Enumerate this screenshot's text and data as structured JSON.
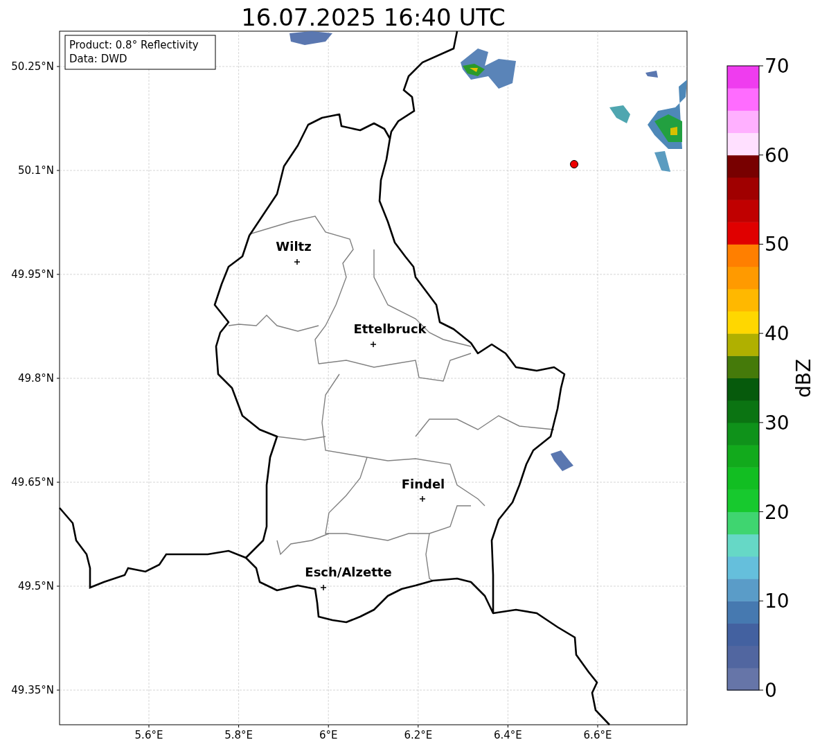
{
  "title": "16.07.2025 16:40 UTC",
  "info_box": [
    "Product: 0.8° Reflectivity",
    "Data: DWD"
  ],
  "lat_ticks": [
    "50.25°N",
    "50.1°N",
    "49.95°N",
    "49.8°N",
    "49.65°N",
    "49.5°N",
    "49.35°N"
  ],
  "lon_ticks": [
    "5.6°E",
    "5.8°E",
    "6°E",
    "6.2°E",
    "6.4°E",
    "6.6°E"
  ],
  "cities": [
    {
      "name": "Wiltz"
    },
    {
      "name": "Ettelbruck"
    },
    {
      "name": "Findel"
    },
    {
      "name": "Esch/Alzette"
    }
  ],
  "colorbar": {
    "label": "dBZ",
    "ticks": [
      "70",
      "60",
      "50",
      "40",
      "30",
      "20",
      "10",
      "0"
    ]
  }
}
